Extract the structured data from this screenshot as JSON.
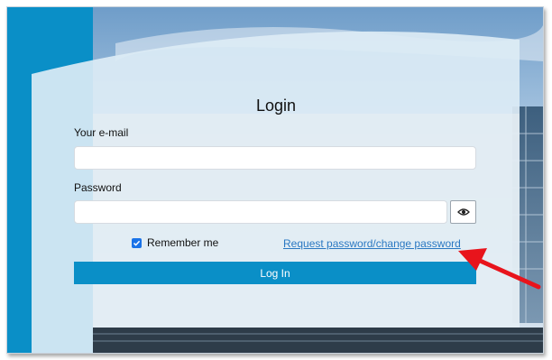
{
  "login": {
    "title": "Login",
    "email_label": "Your e-mail",
    "email_value": "",
    "password_label": "Password",
    "password_value": "",
    "show_password_icon": "eye-icon",
    "remember_label": "Remember me",
    "remember_checked": true,
    "reset_link": "Request password/change password",
    "submit_label": "Log In"
  },
  "colors": {
    "accent": "#0a8fc7",
    "link": "#2a78c2",
    "annotation_arrow": "#e8141c"
  }
}
